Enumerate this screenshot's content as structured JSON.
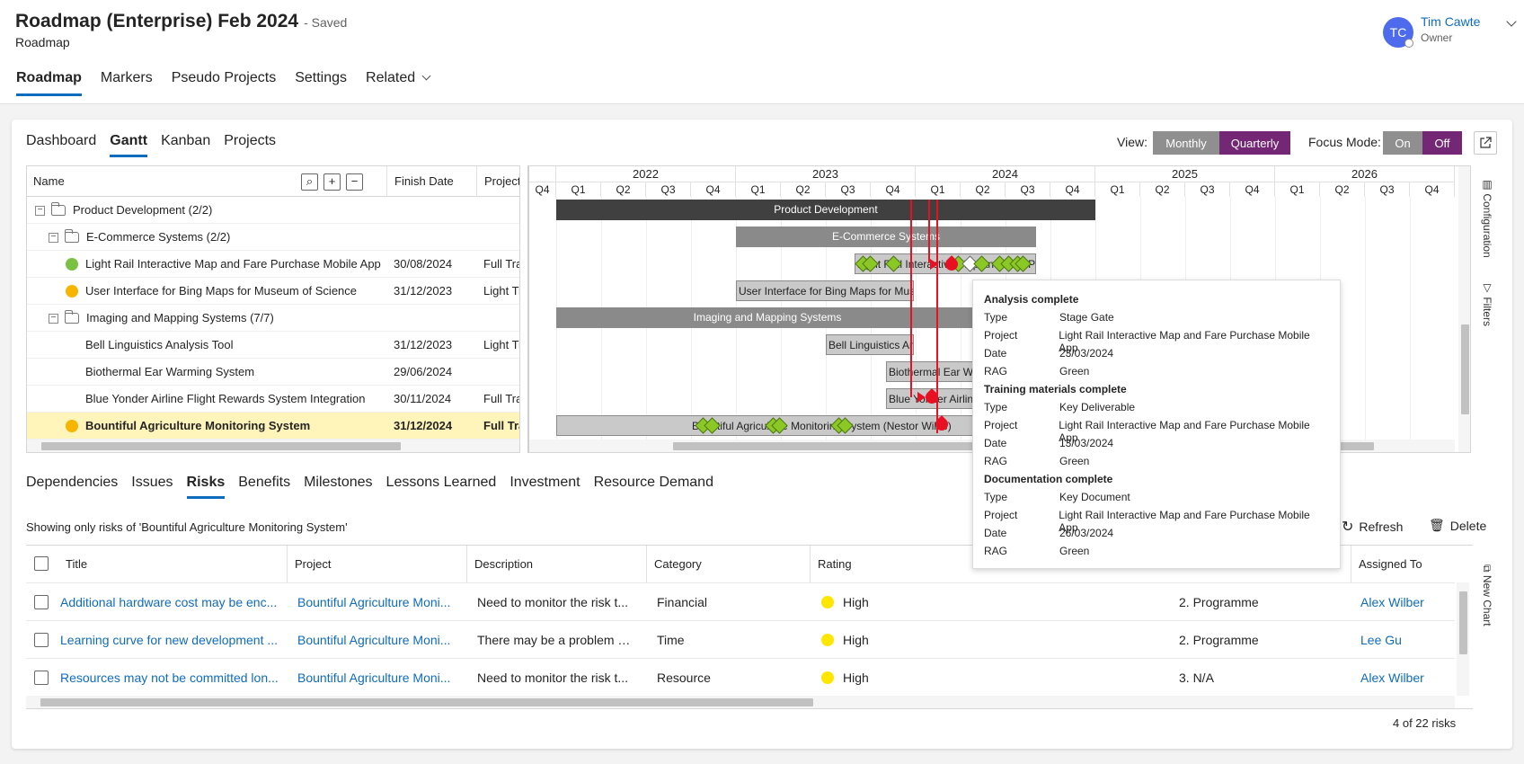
{
  "header": {
    "title": "Roadmap (Enterprise) Feb 2024",
    "saved": "- Saved",
    "subtitle": "Roadmap",
    "tabs": [
      "Roadmap",
      "Markers",
      "Pseudo Projects",
      "Settings",
      "Related"
    ],
    "user": {
      "initials": "TC",
      "name": "Tim Cawte",
      "role": "Owner"
    }
  },
  "subtabs": [
    "Dashboard",
    "Gantt",
    "Kanban",
    "Projects"
  ],
  "view": {
    "label": "View:",
    "monthly": "Monthly",
    "quarterly": "Quarterly"
  },
  "focus": {
    "label": "Focus Mode:",
    "on": "On",
    "off": "Off"
  },
  "gantt": {
    "columns": {
      "name": "Name",
      "finish": "Finish Date",
      "project": "Project"
    },
    "header_buttons": [
      "⌕",
      "+",
      "−"
    ],
    "rows": [
      {
        "name": "Product Development (2/2)",
        "finish": "",
        "project": "",
        "group": true
      },
      {
        "name": "E-Commerce Systems (2/2)",
        "finish": "",
        "project": "",
        "group": true
      },
      {
        "name": "Light Rail Interactive Map and Fare Purchase Mobile App",
        "finish": "30/08/2024",
        "project": "Full Tra",
        "rag": "#7ac143"
      },
      {
        "name": "User Interface for Bing Maps for Museum of Science",
        "finish": "31/12/2023",
        "project": "Light Tr",
        "rag": "#f7b500"
      },
      {
        "name": "Imaging and Mapping Systems (7/7)",
        "finish": "",
        "project": "",
        "group": true
      },
      {
        "name": "Bell Linguistics Analysis Tool",
        "finish": "31/12/2023",
        "project": "Light Tr"
      },
      {
        "name": "Biothermal Ear Warming System",
        "finish": "29/06/2024",
        "project": ""
      },
      {
        "name": "Blue Yonder Airline Flight Rewards System Integration",
        "finish": "30/11/2024",
        "project": "Full Tra"
      },
      {
        "name": "Bountiful Agriculture Monitoring System",
        "finish": "31/12/2024",
        "project": "Full Tra",
        "rag": "#f7b500",
        "selected": true
      }
    ],
    "years": [
      "2022",
      "2023",
      "2024",
      "2025",
      "2026"
    ],
    "quarters": [
      "Q4",
      "Q1",
      "Q2",
      "Q3",
      "Q4",
      "Q1",
      "Q2",
      "Q3",
      "Q4",
      "Q1",
      "Q2",
      "Q3",
      "Q4",
      "Q1",
      "Q2",
      "Q3",
      "Q4",
      "Q1",
      "Q2",
      "Q3",
      "Q4"
    ],
    "bars": [
      {
        "label": "Product Development",
        "style": "dark",
        "row": 0
      },
      {
        "label": "E-Commerce Systems",
        "style": "mid",
        "row": 1
      },
      {
        "label": "Light Rail Interactive Map and Fare Purchase Mobile App",
        "style": "light",
        "row": 2
      },
      {
        "label": "User Interface for Bing Maps for Museum of Science",
        "style": "light",
        "row": 3
      },
      {
        "label": "Imaging and Mapping Systems",
        "style": "mid",
        "row": 4
      },
      {
        "label": "Bell Linguistics Analysis Tool",
        "style": "light",
        "row": 5
      },
      {
        "label": "Biothermal Ear Warming System",
        "style": "light",
        "row": 6
      },
      {
        "label": "Blue Yonder Airline Flight Rewards System Integration",
        "style": "light",
        "row": 7
      },
      {
        "label": "Bountiful Agriculture Monitoring System (Nestor Wilke)",
        "style": "light",
        "row": 8
      }
    ],
    "side_tabs": [
      "Configuration",
      "Filters"
    ]
  },
  "tooltip": [
    {
      "title": "Analysis complete",
      "fields": [
        [
          "Type",
          "Stage Gate"
        ],
        [
          "Project",
          "Light Rail Interactive Map and Fare Purchase Mobile App"
        ],
        [
          "Date",
          "23/03/2024"
        ],
        [
          "RAG",
          "Green"
        ]
      ]
    },
    {
      "title": "Training materials complete",
      "fields": [
        [
          "Type",
          "Key Deliverable"
        ],
        [
          "Project",
          "Light Rail Interactive Map and Fare Purchase Mobile App"
        ],
        [
          "Date",
          "13/03/2024"
        ],
        [
          "RAG",
          "Green"
        ]
      ]
    },
    {
      "title": "Documentation complete",
      "fields": [
        [
          "Type",
          "Key Document"
        ],
        [
          "Project",
          "Light Rail Interactive Map and Fare Purchase Mobile App"
        ],
        [
          "Date",
          "26/03/2024"
        ],
        [
          "RAG",
          "Green"
        ]
      ]
    }
  ],
  "detail_tabs": [
    "Dependencies",
    "Issues",
    "Risks",
    "Benefits",
    "Milestones",
    "Lessons Learned",
    "Investment",
    "Resource Demand"
  ],
  "risks": {
    "showing": "Showing only risks of 'Bountiful Agriculture Monitoring System'",
    "refresh": "Refresh",
    "delete": "Delete",
    "new_chart": "New Chart",
    "columns": [
      "Title",
      "Project",
      "Description",
      "Category",
      "Rating",
      "Assigned To"
    ],
    "rows": [
      {
        "title": "Additional hardware cost may be enc...",
        "project": "Bountiful Agriculture Moni...",
        "description": "Need to monitor the risk t...",
        "category": "Financial",
        "rating": "High",
        "level": "2. Programme",
        "assigned": "Alex Wilber"
      },
      {
        "title": "Learning curve for new development ...",
        "project": "Bountiful Agriculture Moni...",
        "description": "There may be a problem wi...",
        "category": "Time",
        "rating": "High",
        "level": "2. Programme",
        "assigned": "Lee Gu"
      },
      {
        "title": "Resources may not be committed lon...",
        "project": "Bountiful Agriculture Moni...",
        "description": "Need to monitor the risk t...",
        "category": "Resource",
        "rating": "High",
        "level": "3. N/A",
        "assigned": "Alex Wilber"
      }
    ],
    "count": "4 of 22 risks"
  },
  "colors": {
    "accent": "#0f6cbd",
    "purple": "#742774",
    "milestone_green": "#8bc826",
    "dependency_red": "#e81123"
  }
}
